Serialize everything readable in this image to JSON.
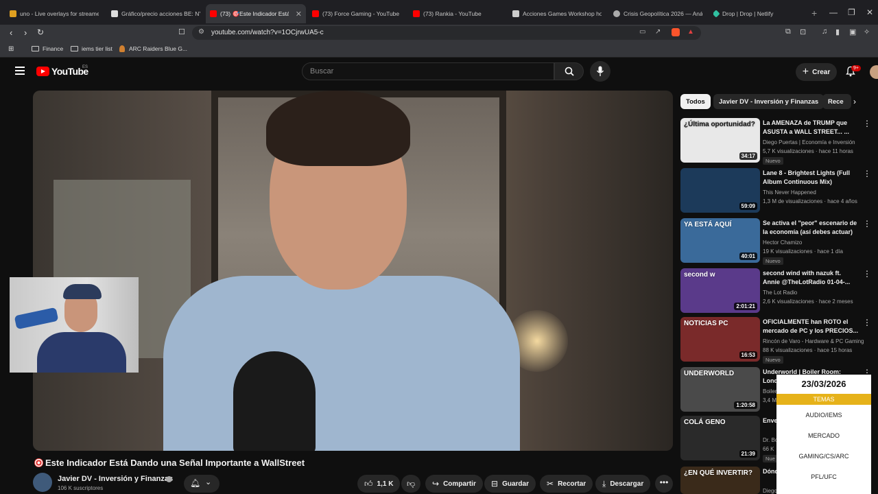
{
  "browser": {
    "tabs": [
      {
        "title": "uno - Live overlays for streamer",
        "favicon_color": "#e0a020"
      },
      {
        "title": "Gráfico/precio acciones BE: NYS",
        "favicon_color": "#dddddd"
      },
      {
        "title": "(73) 🎯Este Indicador Está",
        "favicon_color": "#ff0000",
        "active": true
      },
      {
        "title": "(73) Force Gaming - YouTube",
        "favicon_color": "#ff0000"
      },
      {
        "title": "(73) Rankia - YouTube",
        "favicon_color": "#ff0000"
      },
      {
        "title": "Acciones Games Workshop ho",
        "favicon_color": "#cccccc"
      },
      {
        "title": "Crisis Geopolítica 2026 — Anál",
        "favicon_color": "#aaaaaa"
      },
      {
        "title": "Drop | Drop | Netlify",
        "favicon_color": "#30c0a0"
      }
    ],
    "url": "youtube.com/watch?v=1OCjrwUA5-c",
    "bookmarks": [
      {
        "label": "Finance",
        "icon": "folder-icon"
      },
      {
        "label": "iems tier list",
        "icon": "folder-icon"
      },
      {
        "label": "ARC Raiders Blue G...",
        "icon": "arc-icon"
      }
    ]
  },
  "youtube": {
    "logo_text": "YouTube",
    "region": "ES",
    "search_placeholder": "Buscar",
    "create_label": "Crear",
    "notifications_badge": "9+"
  },
  "video": {
    "title": "Este Indicador Está Dando una Señal Importante a WallStreet",
    "channel": "Javier DV - Inversión y Finanzas",
    "subscribers": "106 K suscriptores",
    "likes": "1,1 K",
    "actions": {
      "share": "Compartir",
      "save": "Guardar",
      "clip": "Recortar",
      "download": "Descargar"
    }
  },
  "chips": [
    "Todos",
    "Javier DV - Inversión y Finanzas",
    "Rece"
  ],
  "recommendations": [
    {
      "title": "La AMENAZA de TRUMP que ASUSTA a WALL STREET... ...",
      "channel": "Diego Puertas | Economía e Inversión",
      "meta": "5,7 K visualizaciones · hace 11 horas",
      "duration": "34:17",
      "badge": "Nuevo",
      "thumb_color": "#e8e8e8",
      "thumb_text": "¿Última oportunidad?"
    },
    {
      "title": "Lane 8 - Brightest Lights (Full Album Continuous Mix)",
      "channel": "This Never Happened",
      "meta": "1,3 M de visualizaciones · hace 4 años",
      "duration": "59:09",
      "badge": "",
      "thumb_color": "#1c3a5a",
      "thumb_text": ""
    },
    {
      "title": "Se activa el \"peor\" escenario de la economía (así debes actuar)",
      "channel": "Hector Chamizo",
      "meta": "19 K visualizaciones · hace 1 día",
      "duration": "40:01",
      "badge": "Nuevo",
      "thumb_color": "#3a6a9a",
      "thumb_text": "YA ESTÁ AQUÍ"
    },
    {
      "title": "second wind with nazuk ft. Annie @TheLotRadio 01-04-...",
      "channel": "The Lot Radio",
      "meta": "2,6 K visualizaciones · hace 2 meses",
      "duration": "2:01:21",
      "badge": "",
      "thumb_color": "#5a3a8a",
      "thumb_text": "second w"
    },
    {
      "title": "OFICIALMENTE han ROTO el mercado de PC y los PRECIOS...",
      "channel": "Rincón de Varo - Hardware & PC Gaming",
      "meta": "88 K visualizaciones · hace 15 horas",
      "duration": "16:53",
      "badge": "Nuevo",
      "thumb_color": "#7a2a2a",
      "thumb_text": "NOTICIAS PC"
    },
    {
      "title": "Underworld | Boiler Room: London",
      "channel": "Boiler Room",
      "meta": "3,4 M",
      "duration": "1:20:58",
      "badge": "",
      "thumb_color": "#4a4a4a",
      "thumb_text": "UNDERWORLD"
    },
    {
      "title": "Enve... Colá...",
      "channel": "Dr. Bo...",
      "meta": "66 K",
      "duration": "21:39",
      "badge": "Nue",
      "thumb_color": "#2a2a2a",
      "thumb_text": "COLÁ GENO"
    },
    {
      "title": "Dónd... cons...",
      "channel": "Diego Puertas | Economía e Inversión",
      "meta": "",
      "duration": "",
      "badge": "",
      "thumb_color": "#3a2a1a",
      "thumb_text": "¿EN QUÉ INVERTIR?"
    }
  ],
  "overlay": {
    "date": "23/03/2026",
    "header": "TEMAS",
    "topics": [
      "AUDIO/IEMS",
      "MERCADO",
      "GAMING/CS/ARC",
      "PFL/UFC"
    ],
    "accent": "#e6b21a"
  }
}
